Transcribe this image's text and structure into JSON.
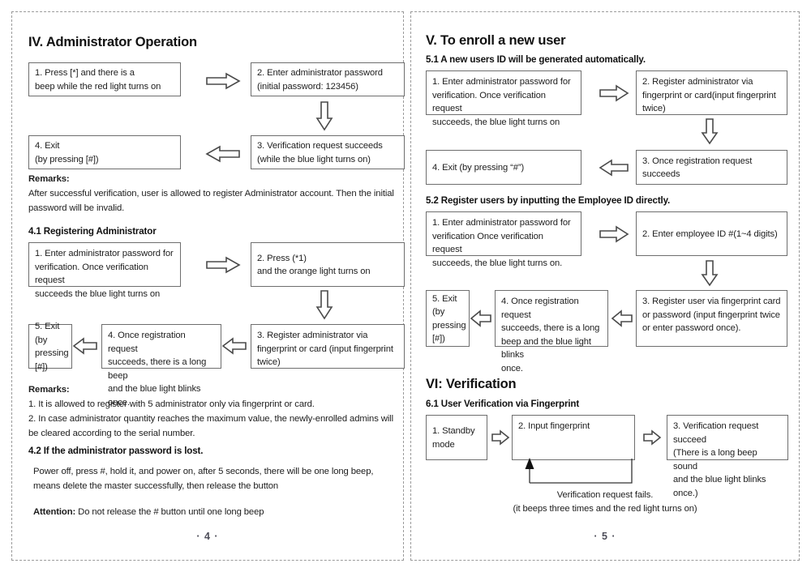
{
  "document": {
    "type": "user-manual-spread",
    "left_page": {
      "page_number": "· 4 ·",
      "section_title": "IV. Administrator Operation",
      "flow_main": [
        {
          "label": "1. Press [*] and there is a\nbeep while the red light turns on"
        },
        {
          "label": "2. Enter administrator password\n(initial password: 123456)"
        },
        {
          "label": "3. Verification request succeeds\n(while the blue light turns on)"
        },
        {
          "label": "4. Exit\n(by pressing [#])"
        }
      ],
      "remarks_1": {
        "heading": "Remarks:",
        "body": "After successful verification, user is allowed to register Administrator account. Then the initial password will be invalid."
      },
      "sub_4_1": {
        "heading": "4.1 Registering Administrator",
        "flow": [
          {
            "label": "1. Enter administrator password for\nverification. Once verification request\nsucceeds the blue light turns on"
          },
          {
            "label": "2. Press (*1)\nand the orange light turns on"
          },
          {
            "label": "3. Register administrator via\nfingerprint or card (input fingerprint\ntwice)"
          },
          {
            "label": "4. Once registration request\nsucceeds, there is a long beep\nand the blue light blinks once."
          },
          {
            "label": "5. Exit (by\npressing [#])"
          }
        ]
      },
      "remarks_2": {
        "heading": "Remarks:",
        "item_1": "1. It is allowed to register with 5 administrator only via fingerprint or card.",
        "item_2": "2. In case administrator quantity reaches the maximum value, the newly-enrolled admins will be cleared according to the serial number."
      },
      "sub_4_2": {
        "heading": "4.2 If the administrator password is lost.",
        "body": "Power off, press #, hold it, and power on, after 5 seconds, there will be one long beep, means delete the master successfully, then release the button",
        "attention_label": "Attention:",
        "attention_body": " Do not release the # button until one long beep"
      }
    },
    "right_page": {
      "page_number": "· 5 ·",
      "section_title": "V. To enroll a new user",
      "sub_5_1": {
        "heading": "5.1 A new users ID will be generated automatically.",
        "flow": [
          {
            "label": "1. Enter administrator password for\nverification. Once verification request\nsucceeds, the blue light turns on"
          },
          {
            "label": "2. Register administrator via\nfingerprint or card(input fingerprint\ntwice)"
          },
          {
            "label": "3. Once registration request succeeds"
          },
          {
            "label": "4. Exit (by pressing “#”)"
          }
        ]
      },
      "sub_5_2": {
        "heading": "5.2 Register users by inputting the Employee ID directly.",
        "flow": [
          {
            "label": "1. Enter administrator password for\nverification Once verification request\nsucceeds, the blue light turns on."
          },
          {
            "label": "2. Enter employee ID #(1~4 digits)"
          },
          {
            "label": "3. Register user via fingerprint card\nor password (input fingerprint twice\nor enter password once)."
          },
          {
            "label": "4. Once registration request\nsucceeds, there is a long\nbeep and the blue light blinks\nonce."
          },
          {
            "label": "5. Exit (by\npressing [#])"
          }
        ]
      },
      "section_title_vi": "VI: Verification",
      "sub_6_1": {
        "heading": "6.1 User Verification via Fingerprint",
        "flow": [
          {
            "label": "1. Standby\nmode"
          },
          {
            "label": "2. Input fingerprint"
          },
          {
            "label": "3. Verification request succeed\n(There is a long beep sound\nand the blue light blinks once.)"
          }
        ],
        "loop_caption_line1": "Verification request fails.",
        "loop_caption_line2": "(it beeps three times and the red light turns on)"
      }
    }
  },
  "colors": {
    "page_border": "#9a9a9a",
    "box_border": "#6e6e6e",
    "arrow": "#4a4a4a",
    "text": "#1d1d1d",
    "page_number": "#4e4e5a"
  }
}
